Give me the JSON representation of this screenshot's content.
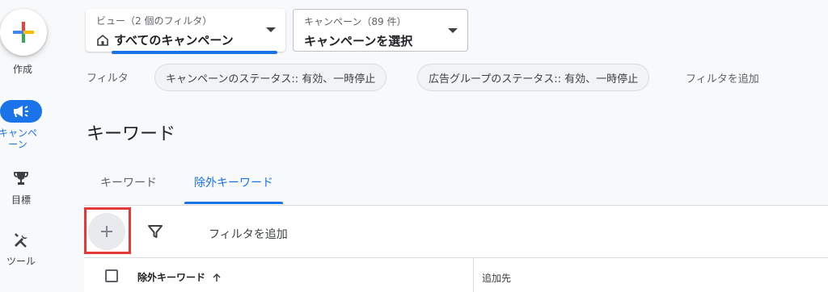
{
  "rail": {
    "create_label": "作成",
    "campaign_label": "キャンペーン",
    "goals_label": "目標",
    "tools_label": "ツール",
    "accent_color": "#1a73e8"
  },
  "selectors": {
    "view": {
      "caption": "ビュー（2 個のフィルタ）",
      "value": "すべてのキャンペーン",
      "icon": "home-icon"
    },
    "campaign": {
      "caption": "キャンペーン（89 件）",
      "value": "キャンペーンを選択"
    }
  },
  "filters": {
    "label": "フィルタ",
    "chips": [
      "キャンペーンのステータス:: 有効、一時停止",
      "広告グループのステータス:: 有効、一時停止"
    ],
    "add_label": "フィルタを追加"
  },
  "page": {
    "title": "キーワード"
  },
  "tabs": [
    {
      "label": "キーワード",
      "active": false
    },
    {
      "label": "除外キーワード",
      "active": true
    }
  ],
  "table": {
    "add_button_icon": "plus-icon",
    "filter_icon": "funnel-icon",
    "add_filter_label": "フィルタを追加",
    "columns": [
      {
        "label": "除外キーワード",
        "sort": "ascending"
      },
      {
        "label": "追加先"
      }
    ],
    "highlight_color": "#e53935"
  }
}
